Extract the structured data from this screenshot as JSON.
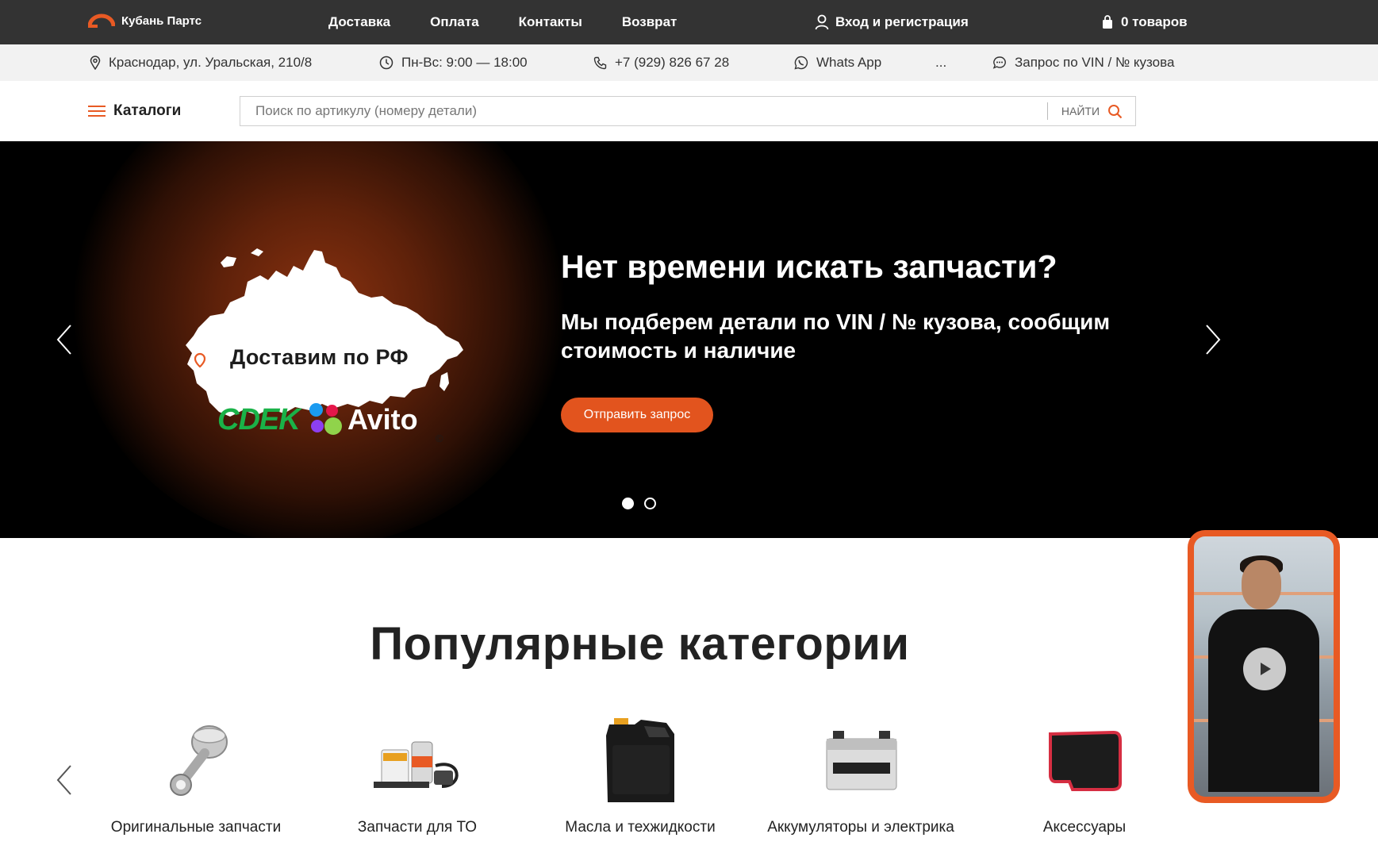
{
  "header": {
    "logo_text": "Кубань Партс",
    "nav": [
      "Доставка",
      "Оплата",
      "Контакты",
      "Возврат"
    ],
    "login": "Вход и регистрация",
    "cart": "0 товаров"
  },
  "info": {
    "address": "Краснодар, ул. Уральская, 210/8",
    "hours": "Пн-Вс: 9:00 — 18:00",
    "phone": "+7 (929) 826 67 28",
    "whatsapp": "Whats App",
    "more": "...",
    "vin_request": "Запрос по VIN / № кузова"
  },
  "search": {
    "catalogs": "Каталоги",
    "placeholder": "Поиск по артикулу (номеру детали)",
    "button": "НАЙТИ"
  },
  "hero": {
    "map_caption": "Доставим по РФ",
    "cdek": "CDEK",
    "avito": "Avito",
    "copyright": "©",
    "title": "Нет времени искать запчасти?",
    "subtitle": "Мы подберем детали по VIN / № кузова, сообщим стоимость и наличие",
    "button": "Отправить запрос",
    "slides_total": 2,
    "active_slide": 1
  },
  "popular": {
    "title": "Популярные категории",
    "categories": [
      {
        "label": "Оригинальные запчасти",
        "icon": "piston-icon"
      },
      {
        "label": "Запчасти для ТО",
        "icon": "maintenance-kit-icon"
      },
      {
        "label": "Масла и техжидкости",
        "icon": "oil-canister-icon"
      },
      {
        "label": "Аккумуляторы и электрика",
        "icon": "battery-icon"
      },
      {
        "label": "Аксессуары",
        "icon": "floor-mat-icon"
      }
    ]
  },
  "colors": {
    "accent": "#e85a24",
    "topbar": "#333333",
    "infobar": "#f2f2f2"
  }
}
